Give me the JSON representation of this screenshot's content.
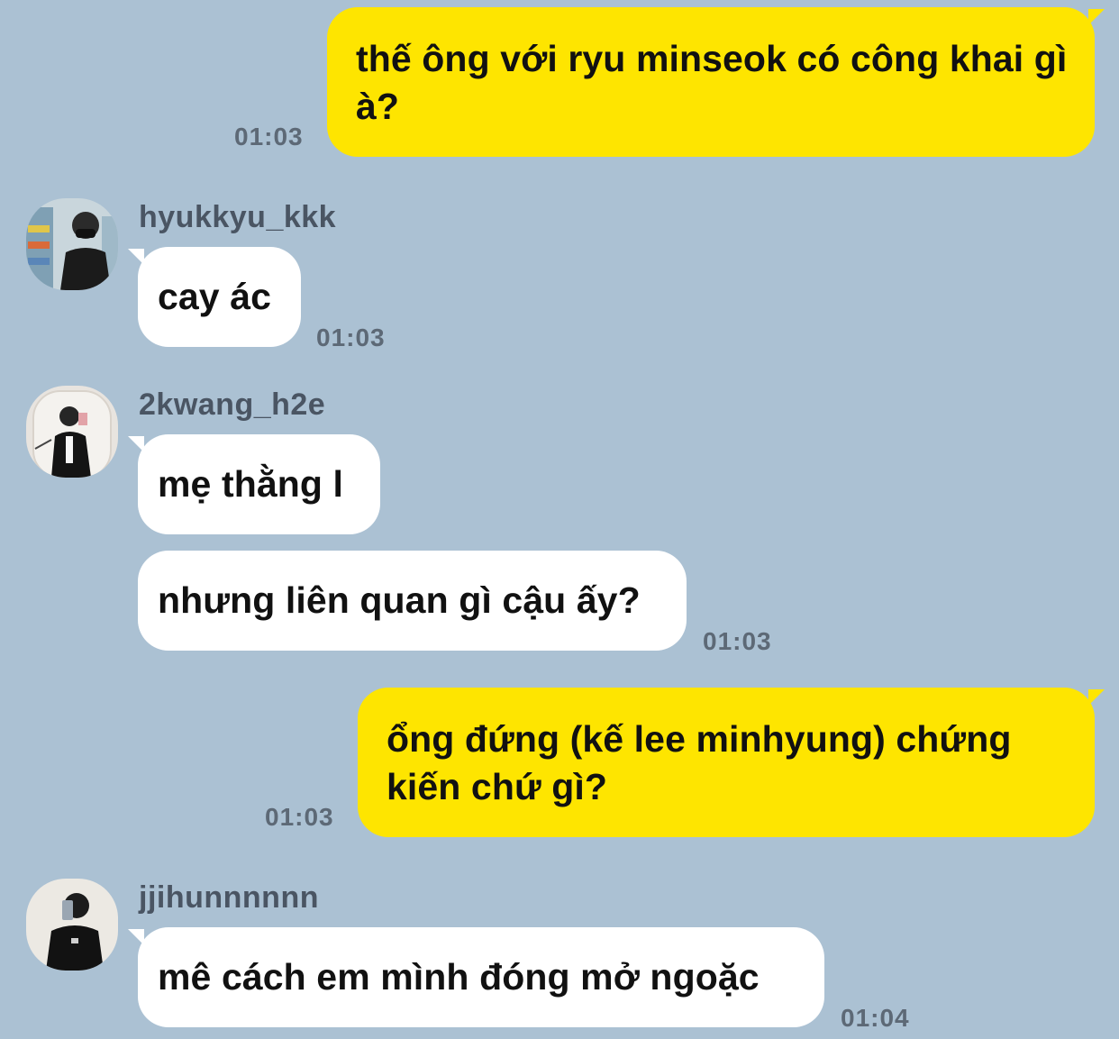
{
  "messages": [
    {
      "text": "thế ông với ryu minseok có công khai gì à?",
      "time": "01:03"
    },
    {
      "sender": "hyukkyu_kkk",
      "text": "cay ác",
      "time": "01:03"
    },
    {
      "sender": "2kwang_h2e",
      "text": "mẹ thằng l"
    },
    {
      "text": "nhưng liên quan gì cậu ấy?",
      "time": "01:03"
    },
    {
      "text": "ổng đứng (kế lee minhyung) chứng kiến chứ gì?",
      "time": "01:03"
    },
    {
      "sender": "jjihunnnnnn",
      "text": "mê cách em mình đóng mở ngoặc",
      "time": "01:04"
    }
  ],
  "colors": {
    "background": "#abc1d3",
    "outgoing_bubble": "#fee500",
    "incoming_bubble": "#ffffff",
    "timestamp": "#5d6976",
    "sender_name": "#4a5563"
  },
  "icons": {
    "avatar_1": "user-avatar-photo",
    "avatar_2": "user-avatar-photo",
    "avatar_3": "user-avatar-photo"
  }
}
